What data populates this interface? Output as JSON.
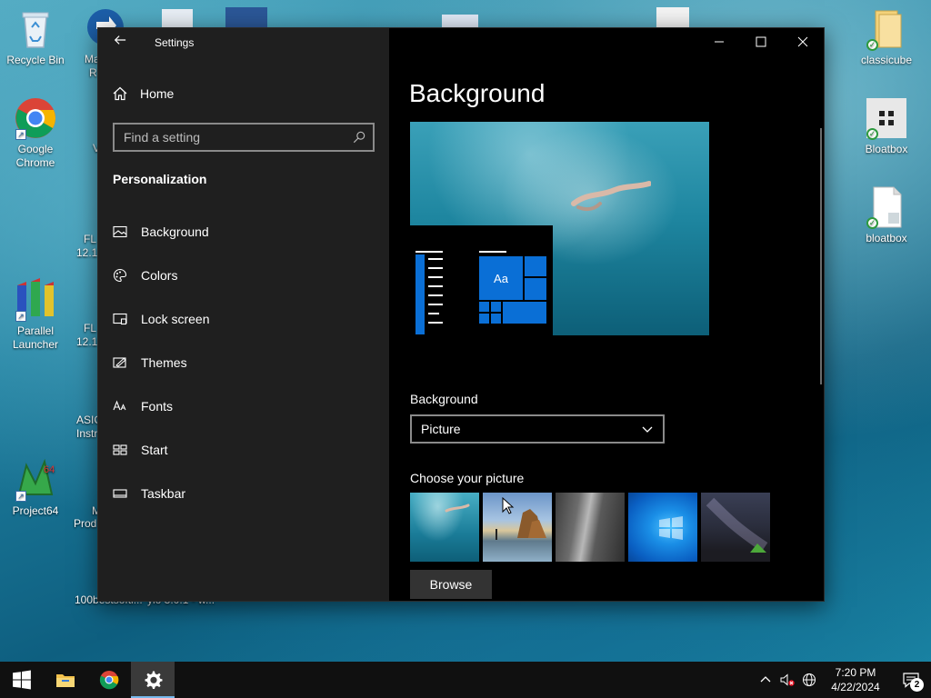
{
  "desktop": {
    "icons_left": [
      {
        "label": "Recycle Bin",
        "icon": "recycle-bin-icon"
      },
      {
        "label": "Google Chrome",
        "icon": "chrome-icon"
      },
      {
        "label": "Parallel Launcher",
        "icon": "parallel-launcher-icon"
      },
      {
        "label": "Project64",
        "icon": "project64-icon"
      }
    ],
    "icons_right": [
      {
        "label": "classicube",
        "icon": "folder-icon"
      },
      {
        "label": "Bloatbox",
        "icon": "bloatbox-icon"
      },
      {
        "label": "bloatbox",
        "icon": "file-icon"
      }
    ],
    "partial_labels": [
      "Ma",
      "R",
      "V",
      "FL",
      "12.1.",
      "FL",
      "12.1.",
      "ASIC",
      "Instr",
      "M",
      "Prod",
      "100bestsofti...",
      "ylo 3.0.1 - w..."
    ]
  },
  "window": {
    "title": "Settings",
    "home_label": "Home",
    "search_placeholder": "Find a setting",
    "section_title": "Personalization",
    "nav_items": [
      {
        "label": "Background",
        "icon": "picture-icon"
      },
      {
        "label": "Colors",
        "icon": "palette-icon"
      },
      {
        "label": "Lock screen",
        "icon": "lock-screen-icon"
      },
      {
        "label": "Themes",
        "icon": "themes-icon"
      },
      {
        "label": "Fonts",
        "icon": "fonts-icon"
      },
      {
        "label": "Start",
        "icon": "start-layout-icon"
      },
      {
        "label": "Taskbar",
        "icon": "taskbar-icon"
      }
    ],
    "page_title": "Background",
    "preview_tile_text": "Aa",
    "background_label": "Background",
    "background_value": "Picture",
    "choose_picture_label": "Choose your picture",
    "browse_label": "Browse"
  },
  "taskbar": {
    "apps": [
      "start-icon",
      "file-explorer-icon",
      "chrome-icon",
      "settings-icon"
    ],
    "active_app": "settings-icon",
    "time": "7:20 PM",
    "date": "4/22/2024",
    "notification_count": "2"
  },
  "colors": {
    "accent": "#0a6fd6",
    "sidebar_bg": "#1f1f1f",
    "content_bg": "#000000",
    "taskbar_bg": "#101010"
  }
}
